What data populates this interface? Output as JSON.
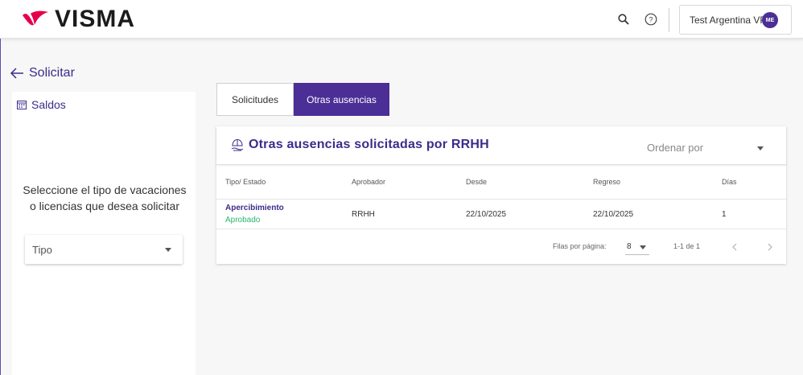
{
  "header": {
    "logo_text": "VISMA",
    "brand_color": "#e5004b",
    "user_name": "Test Argentina VP",
    "avatar_initials": "ME",
    "icons": [
      "search-icon",
      "help-icon"
    ]
  },
  "nav": {
    "back_label": "Solicitar"
  },
  "sidebar": {
    "saldos_label": "Saldos",
    "prompt_line1": "Seleccione el tipo de vacaciones",
    "prompt_line2": "o licencias que desea solicitar",
    "tipo_placeholder": "Tipo"
  },
  "tabs": [
    {
      "label": "Solicitudes",
      "active": false
    },
    {
      "label": "Otras ausencias",
      "active": true
    }
  ],
  "card": {
    "title": "Otras ausencias solicitadas por RRHH",
    "order_placeholder": "Ordenar por",
    "columns": [
      "Tipo/ Estado",
      "Aprobador",
      "Desde",
      "Regreso",
      "Días"
    ],
    "rows": [
      {
        "tipo": "Apercibimiento",
        "estado": "Aprobado",
        "aprobador": "RRHH",
        "desde": "22/10/2025",
        "regreso": "22/10/2025",
        "dias": "1"
      }
    ],
    "pagination": {
      "rows_label": "Filas por página:",
      "rows_value": "8",
      "range": "1-1 de 1"
    }
  },
  "colors": {
    "accent": "#4b2e96",
    "status_approved": "#2bb673"
  }
}
